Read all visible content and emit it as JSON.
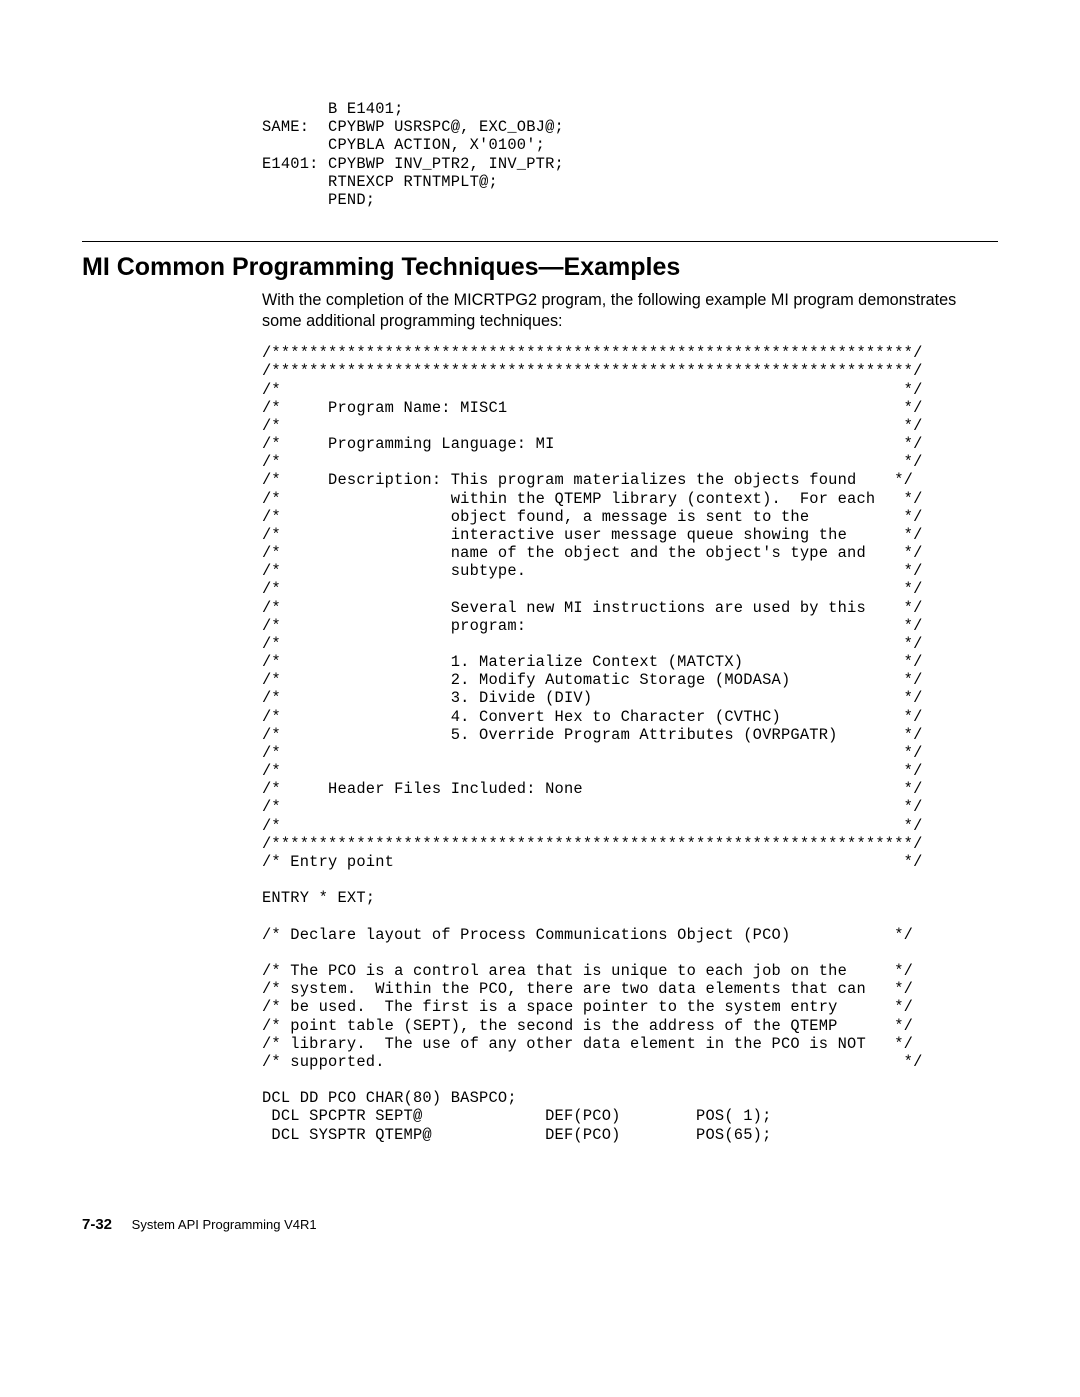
{
  "code_block_1": "       B E1401;\nSAME:  CPYBWP USRSPC@, EXC_OBJ@;\n       CPYBLA ACTION, X'0100';\nE1401: CPYBWP INV_PTR2, INV_PTR;\n       RTNEXCP RTNTMPLT@;\n       PEND;",
  "section_heading": "MI Common Programming Techniques—Examples",
  "intro_para": "With the completion of the MICRTPG2 program, the following example MI program demonstrates some additional programming techniques:",
  "code_block_2": "/********************************************************************/\n/********************************************************************/\n/*                                                                  */\n/*     Program Name: MISC1                                          */\n/*                                                                  */\n/*     Programming Language: MI                                     */\n/*                                                                  */\n/*     Description: This program materializes the objects found    */\n/*                  within the QTEMP library (context).  For each   */\n/*                  object found, a message is sent to the          */\n/*                  interactive user message queue showing the      */\n/*                  name of the object and the object's type and    */\n/*                  subtype.                                        */\n/*                                                                  */\n/*                  Several new MI instructions are used by this    */\n/*                  program:                                        */\n/*                                                                  */\n/*                  1. Materialize Context (MATCTX)                 */\n/*                  2. Modify Automatic Storage (MODASA)            */\n/*                  3. Divide (DIV)                                 */\n/*                  4. Convert Hex to Character (CVTHC)             */\n/*                  5. Override Program Attributes (OVRPGATR)       */\n/*                                                                  */\n/*                                                                  */\n/*     Header Files Included: None                                  */\n/*                                                                  */\n/*                                                                  */\n/********************************************************************/\n/* Entry point                                                      */\n\nENTRY * EXT;\n\n/* Declare layout of Process Communications Object (PCO)           */\n\n/* The PCO is a control area that is unique to each job on the     */\n/* system.  Within the PCO, there are two data elements that can   */\n/* be used.  The first is a space pointer to the system entry      */\n/* point table (SEPT), the second is the address of the QTEMP      */\n/* library.  The use of any other data element in the PCO is NOT   */\n/* supported.                                                       */\n\nDCL DD PCO CHAR(80) BASPCO;\n DCL SPCPTR SEPT@             DEF(PCO)        POS( 1);\n DCL SYSPTR QTEMP@            DEF(PCO)        POS(65);",
  "footer": {
    "page_number": "7-32",
    "doc_title": "System API Programming V4R1"
  }
}
